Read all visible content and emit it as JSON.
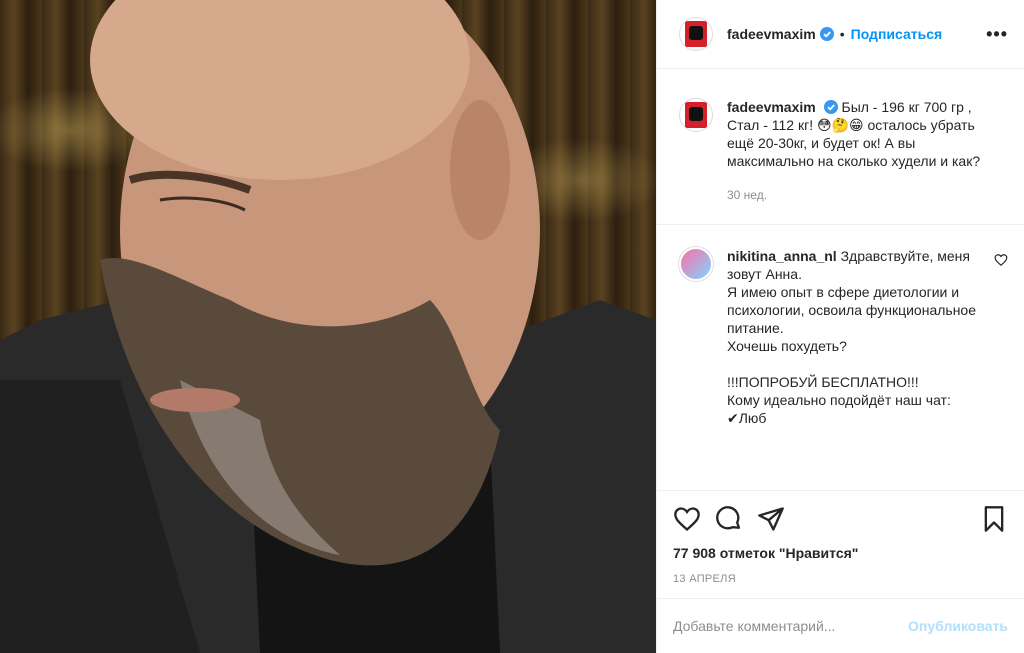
{
  "post": {
    "username": "fadeevmaxim",
    "dot": "•",
    "follow_label": "Подписаться",
    "more_label": "•••",
    "caption_text": "Был - 196 кг 700 гр , Стал - 112 кг! 😳🤔😁 осталось убрать ещё 20-30кг, и будет ок! А вы максимально на сколько худели и как?",
    "caption_time": "30 нед.",
    "comments": [
      {
        "username": "nikitina_anna_nl",
        "text": "Здравствуйте, меня зовут Анна.\nЯ имею опыт в сфере диетологии и психологии, освоила функциональное питание.\nХочешь похудеть?\n\n!!!ПОПРОБУЙ БЕСПЛАТНО!!!\nКому идеально подойдёт наш чат:\n✔Люб"
      }
    ],
    "likes": "77 908 отметок \"Нравится\"",
    "date": "13 АПРЕЛЯ",
    "add_comment_placeholder": "Добавьте комментарий...",
    "publish_label": "Опубликовать"
  },
  "colors": {
    "accent": "#0095f6",
    "publish_disabled": "#b2dffc",
    "muted": "#8e8e8e"
  },
  "icons": [
    "verified-icon",
    "more-icon",
    "heart-icon",
    "comment-icon",
    "share-icon",
    "bookmark-icon"
  ]
}
